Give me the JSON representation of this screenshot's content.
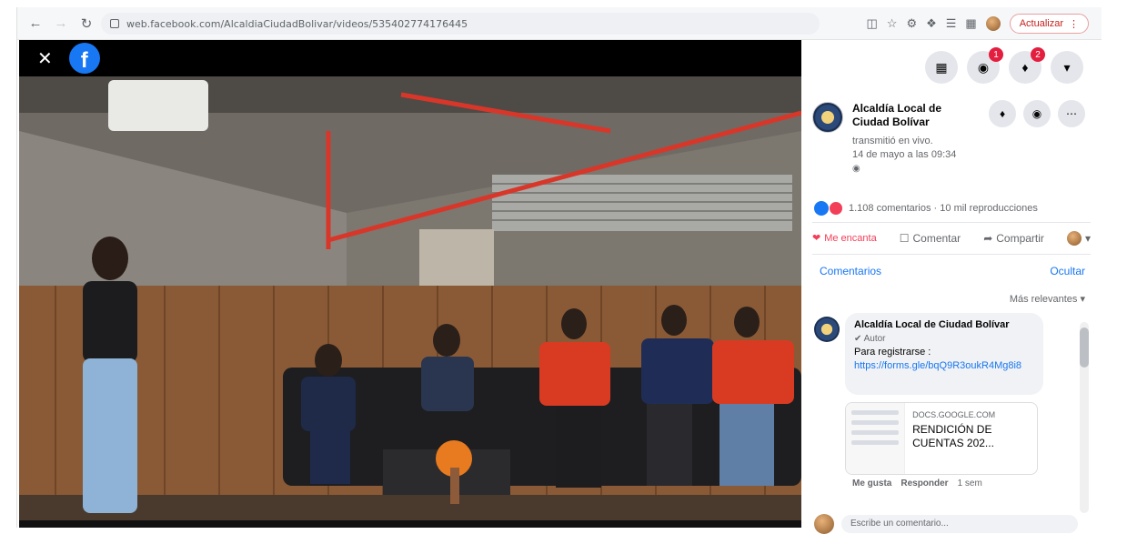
{
  "browser": {
    "url": "web.facebook.com/AlcaldiaCiudadBolivar/videos/535402774176445",
    "update_label": "Actualizar",
    "nav_icons": [
      "back-arrow-icon",
      "forward-arrow-icon",
      "reload-icon"
    ]
  },
  "video": {
    "close_label": "✕",
    "logo_letter": "f"
  },
  "panel": {
    "messenger_badge": "1",
    "notif_badge": "2",
    "page_name": "Alcaldía Local de Ciudad Bolívar",
    "post_meta_line1": "transmitió en vivo.",
    "post_meta_line2": "14 de mayo a las 09:34",
    "stats_text": "1.108 comentarios · 10 mil reproducciones",
    "like_label": "Me encanta",
    "comment_label": "Comentar",
    "share_label": "Compartir",
    "tab_comments": "Comentarios",
    "tab_hide": "Ocultar",
    "sort_label": "Más relevantes ▾",
    "comment": {
      "author": "Alcaldía Local de Ciudad Bolívar",
      "badge": "✔ Autor",
      "text": "Para registrarse :",
      "link": "https://forms.gle/bqQ9R3oukR4Mg8i8",
      "preview_domain": "DOCS.GOOGLE.COM",
      "preview_title": "RENDICIÓN DE CUENTAS 202...",
      "like": "Me gusta",
      "reply": "Responder",
      "time": "1 sem"
    },
    "write_placeholder": "Escribe un comentario..."
  }
}
